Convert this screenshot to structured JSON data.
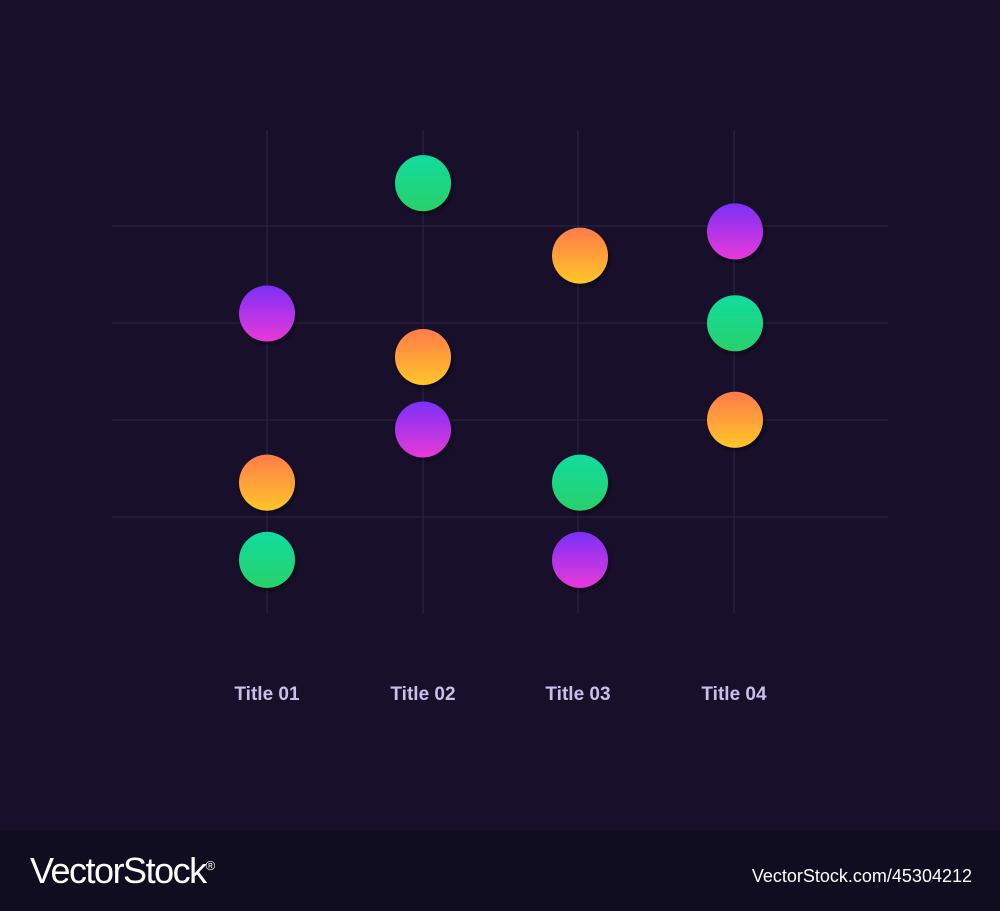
{
  "chart_data": {
    "type": "scatter",
    "categories": [
      "Title 01",
      "Title 02",
      "Title 03",
      "Title 04"
    ],
    "ylim": [
      0,
      5
    ],
    "grid": true,
    "legend": "none",
    "colors": {
      "purple": [
        "#7b2ff7",
        "#e83ad8"
      ],
      "green": [
        "#10dc9f",
        "#2ad16a"
      ],
      "orange": [
        "#ff7b4a",
        "#ffc629"
      ]
    },
    "series": [
      {
        "color": "green",
        "values": [
          0.55,
          4.45,
          1.35,
          3.0
        ]
      },
      {
        "color": "orange",
        "values": [
          1.35,
          2.65,
          3.7,
          2.0
        ]
      },
      {
        "color": "purple",
        "values": [
          3.1,
          1.9,
          0.55,
          3.95
        ]
      }
    ]
  },
  "footer": {
    "brand": "VectorStock",
    "brand_mark": "®",
    "stock_id": "VectorStock.com/45304212"
  }
}
